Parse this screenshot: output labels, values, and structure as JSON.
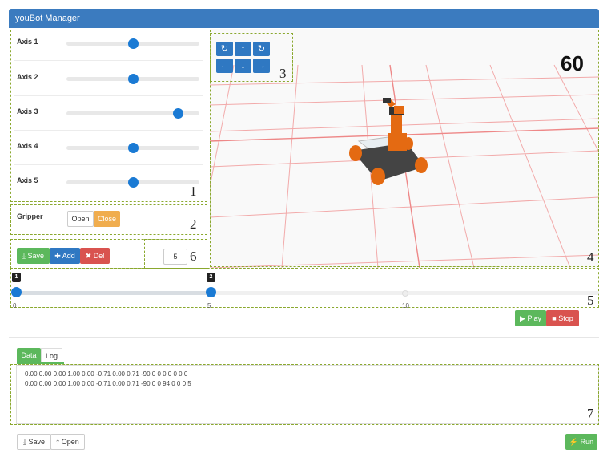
{
  "window": {
    "title": "youBot Manager"
  },
  "axes": [
    {
      "label": "Axis 1",
      "value": 0.5
    },
    {
      "label": "Axis 2",
      "value": 0.5
    },
    {
      "label": "Axis 3",
      "value": 0.84
    },
    {
      "label": "Axis 4",
      "value": 0.5
    },
    {
      "label": "Axis 5",
      "value": 0.5
    }
  ],
  "gripper": {
    "label": "Gripper",
    "open_label": "Open",
    "close_label": "Close",
    "state": "Close"
  },
  "actions": {
    "save_label": "Save",
    "add_label": "Add",
    "del_label": "Del",
    "step_value": "5"
  },
  "view": {
    "fps": "60"
  },
  "timeline": {
    "ticks": [
      "0",
      "5",
      "10"
    ],
    "markers": [
      "1",
      "2"
    ],
    "marker_positions": [
      0,
      5
    ],
    "max": 20
  },
  "player": {
    "play_label": "Play",
    "stop_label": "Stop"
  },
  "tabs": {
    "data_label": "Data",
    "log_label": "Log",
    "active": "Data"
  },
  "data_lines": [
    "0.00 0.00 0.00 1.00 0.00 -0.71 0.00 0.71 -90 0 0 0 0 0 0 0",
    "0.00 0.00 0.00 1.00 0.00 -0.71 0.00 0.71 -90 0 0 94 0 0 0 5"
  ],
  "footer": {
    "save_label": "Save",
    "open_label": "Open",
    "run_label": "Run"
  },
  "region_numbers": [
    "1",
    "2",
    "3",
    "4",
    "5",
    "6",
    "7"
  ],
  "colors": {
    "titlebar": "#3b7bbf",
    "primary": "#2f78c2",
    "success": "#5cb85c",
    "danger": "#d9534f",
    "warning": "#f0ad4e",
    "grid": "#f2aaaa"
  }
}
